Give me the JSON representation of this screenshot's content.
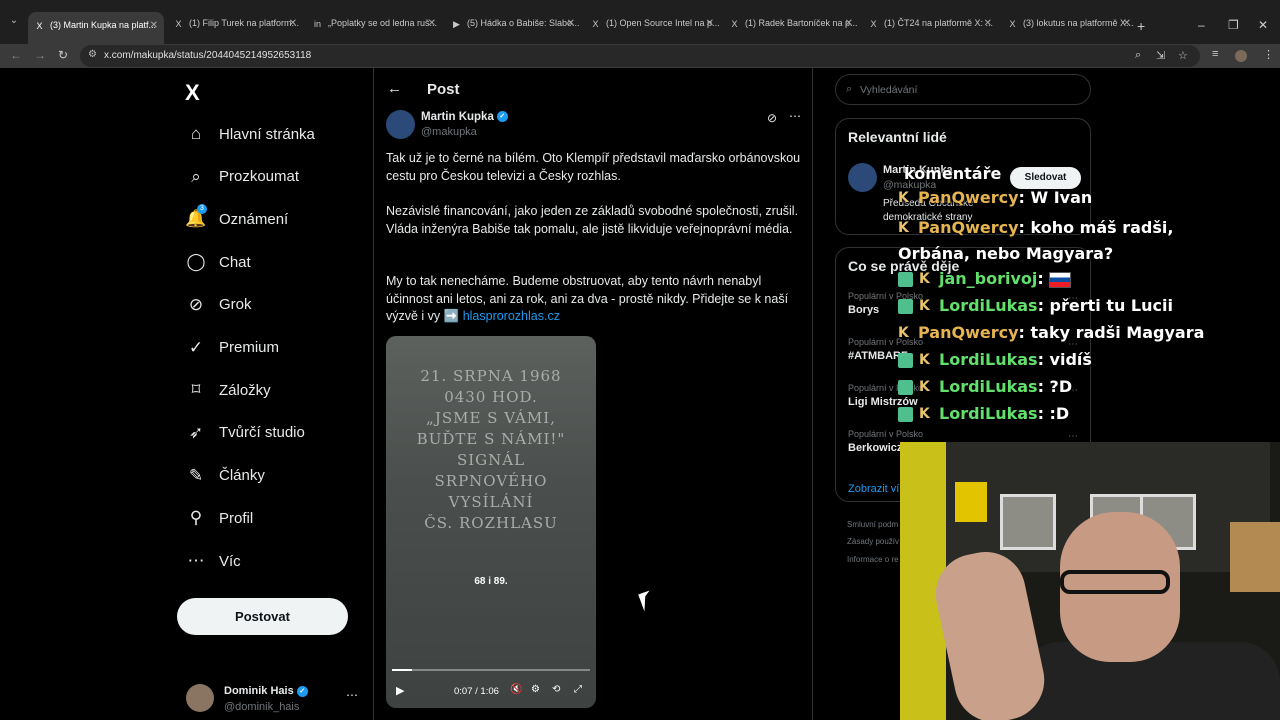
{
  "browser": {
    "tabs": [
      {
        "title": "(3) Martin Kupka na platf...",
        "favicon": "X",
        "active": true
      },
      {
        "title": "(1) Filip Turek na platform...",
        "favicon": "X",
        "active": false
      },
      {
        "title": "„Poplatky se od ledna ruš...",
        "favicon": "in",
        "active": false
      },
      {
        "title": "(5) Hádka o Babiše: Slabo...",
        "favicon": "▶",
        "active": false
      },
      {
        "title": "(1) Open Source Intel na p...",
        "favicon": "X",
        "active": false
      },
      {
        "title": "(1) Radek Bartoníček na p...",
        "favicon": "X",
        "active": false
      },
      {
        "title": "(1) ČT24 na platformě X: ...",
        "favicon": "X",
        "active": false
      },
      {
        "title": "(3) lokutus na platformě X...",
        "favicon": "X",
        "active": false
      }
    ],
    "url": "x.com/makupka/status/2044045214952653118"
  },
  "sidebar": {
    "logo": "X",
    "items": [
      {
        "label": "Hlavní stránka",
        "icon": "home-icon",
        "glyph": "⌂"
      },
      {
        "label": "Prozkoumat",
        "icon": "search-icon",
        "glyph": "⌕"
      },
      {
        "label": "Oznámení",
        "icon": "bell-icon",
        "glyph": "🔔",
        "badge": "3"
      },
      {
        "label": "Chat",
        "icon": "chat-icon",
        "glyph": "◯"
      },
      {
        "label": "Grok",
        "icon": "grok-icon",
        "glyph": "⊘"
      },
      {
        "label": "Premium",
        "icon": "premium-icon",
        "glyph": "✓"
      },
      {
        "label": "Záložky",
        "icon": "bookmark-icon",
        "glyph": "⌑"
      },
      {
        "label": "Tvůrčí studio",
        "icon": "rocket-icon",
        "glyph": "➶"
      },
      {
        "label": "Články",
        "icon": "article-icon",
        "glyph": "✎"
      },
      {
        "label": "Profil",
        "icon": "profile-icon",
        "glyph": "⚲"
      },
      {
        "label": "Víc",
        "icon": "more-icon",
        "glyph": "⋯"
      }
    ],
    "post_button": "Postovat",
    "account": {
      "name": "Dominik Hais",
      "handle": "@dominik_hais"
    }
  },
  "post": {
    "header": "Post",
    "author": {
      "name": "Martin Kupka",
      "handle": "@makupka"
    },
    "paragraphs": [
      "Tak už je to černé na bílém. Oto Klempíř představil maďarsko orbánovskou cestu pro Českou televizi a Česky rozhlas.",
      "Nezávislé financování, jako jeden ze základů svobodné společnosti, zrušil. Vláda inženýra Babiše tak pomalu, ale jistě likviduje veřejnoprávní média.",
      "My to tak nenecháme. Budeme obstruovat, aby tento návrh nenabyl účinnost ani letos, ani za rok, ani za dva - prostě nikdy. Přidejte se k naší výzvě i vy ➡️ "
    ],
    "link": "hlasprorozhlas.cz",
    "video": {
      "plaque_lines": [
        "21. SRPNA 1968",
        "0430 HOD.",
        "„JSME S VÁMI,",
        "BUĎTE S NÁMI!\"",
        "SIGNÁL",
        "SRPNOVÉHO",
        "VYSÍLÁNÍ",
        "ČS. ROZHLASU"
      ],
      "counter": "68 i 89.",
      "time": "0:07 / 1:06",
      "progress": 0.1
    }
  },
  "right": {
    "search_placeholder": "Vyhledávání",
    "relevant": {
      "title": "Relevantní lidé",
      "name": "Martin Kupka",
      "handle": "@makupka",
      "bio": "Předseda Občanské demokratické strany",
      "follow": "Sledovat"
    },
    "trends": {
      "title": "Co se právě děje",
      "items": [
        {
          "category": "Populární v Polsko",
          "name": "Borys"
        },
        {
          "category": "Populární v Polsko",
          "name": "#ATMBARF"
        },
        {
          "category": "Populární v Polsko",
          "name": "Ligi Mistrzów"
        },
        {
          "category": "Populární v Polsko",
          "name": "Berkowicz"
        }
      ],
      "show_more": "Zobrazit ví"
    },
    "footer": [
      "Smluvní podm",
      "Zásady použív",
      "Informace o re"
    ]
  },
  "chat_overlay": {
    "title": "komentáře",
    "messages": [
      {
        "user": "PanQwercy",
        "text": "W Ivan",
        "badge": "k"
      },
      {
        "user": "PanQwercy",
        "text": "koho máš radši, Orbána, nebo Magyara?",
        "badge": "k"
      },
      {
        "user": "jan_borivoj",
        "text": "",
        "badge": "sub",
        "flag": true
      },
      {
        "user": "LordiLukas",
        "text": "přerti tu Lucii",
        "badge": "sub"
      },
      {
        "user": "PanQwercy",
        "text": "taky radši Magyara",
        "badge": "k"
      },
      {
        "user": "LordiLukas",
        "text": "vidíš",
        "badge": "sub"
      },
      {
        "user": "LordiLukas",
        "text": "?D",
        "badge": "sub"
      },
      {
        "user": "LordiLukas",
        "text": ":D",
        "badge": "sub"
      }
    ]
  },
  "colors": {
    "accent": "#1d9bf0",
    "bg": "#000000",
    "border": "#2f3336",
    "muted": "#71767b"
  }
}
